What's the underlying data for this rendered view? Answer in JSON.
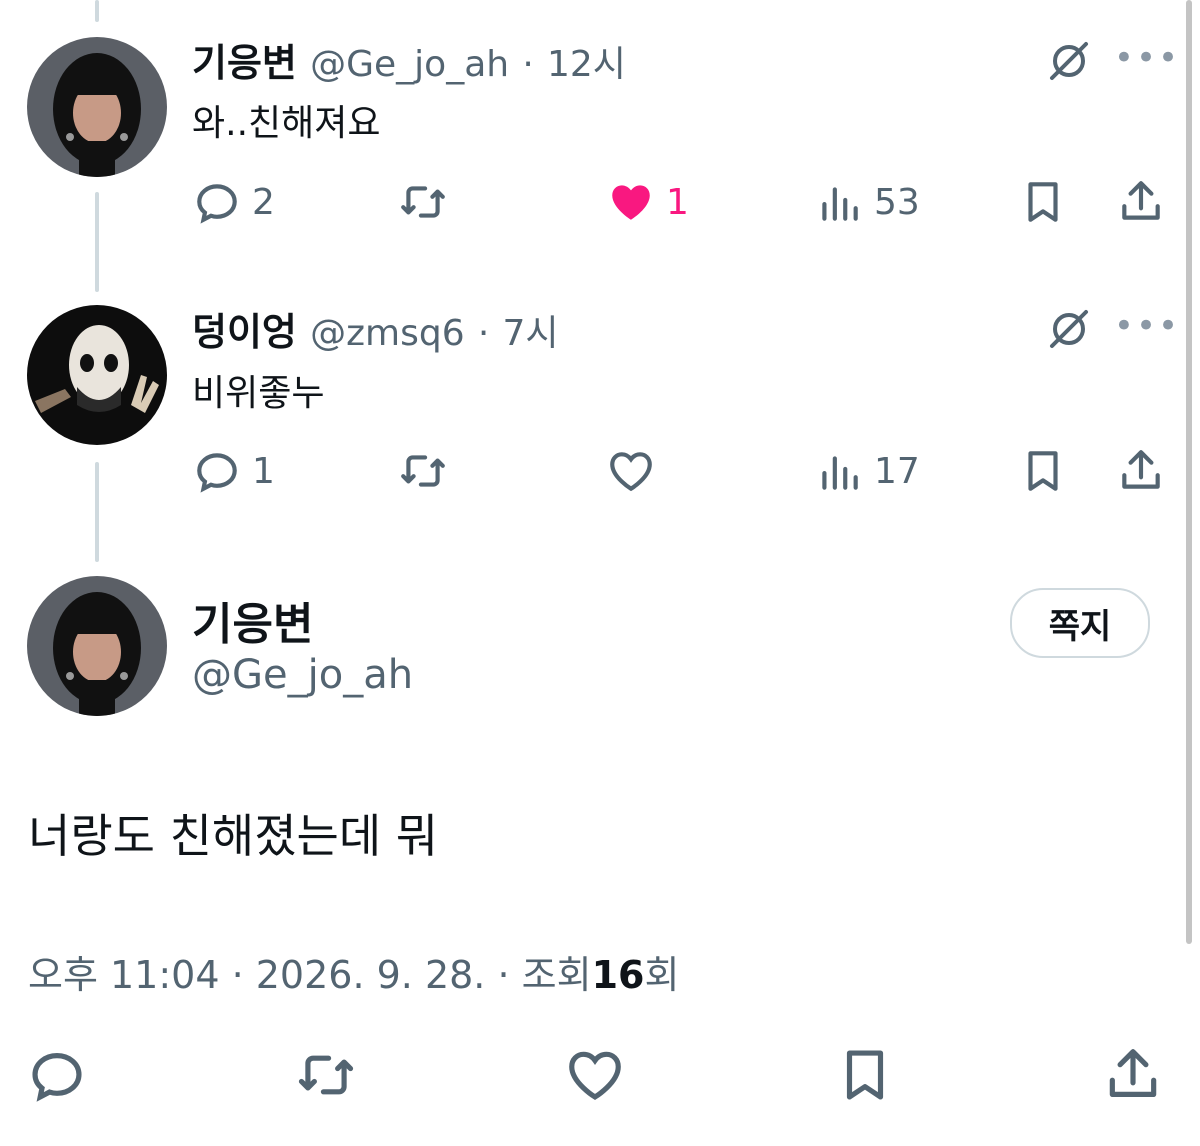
{
  "replies": [
    {
      "name": "기응변",
      "handle": "@Ge_jo_ah",
      "separator": "·",
      "time": "12시",
      "text": "와..친해져요",
      "reply_count": "2",
      "like_count": "1",
      "view_count": "53",
      "liked": true
    },
    {
      "name": "덩이엉",
      "handle": "@zmsq6",
      "separator": "·",
      "time": "7시",
      "text": "비위좋누",
      "reply_count": "1",
      "like_count": "",
      "view_count": "17",
      "liked": false
    }
  ],
  "main_post": {
    "name": "기응변",
    "handle": "@Ge_jo_ah",
    "dm_button": "쪽지",
    "text": "너랑도 친해졌는데 뭐",
    "timestamp": "오후 11:04 · 2026. 9. 28. ·",
    "views_prefix": "조회",
    "views": "16",
    "views_suffix": "회"
  },
  "icons": {
    "reply": "reply-icon",
    "retweet": "retweet-icon",
    "like": "heart-icon",
    "views": "views-icon",
    "bookmark": "bookmark-icon",
    "share": "share-icon",
    "grok": "grok-icon",
    "more": "more-dots-icon"
  },
  "colors": {
    "like_active": "#f91880",
    "muted": "#536471",
    "text": "#0f1419",
    "thread_line": "#cfd9de"
  }
}
